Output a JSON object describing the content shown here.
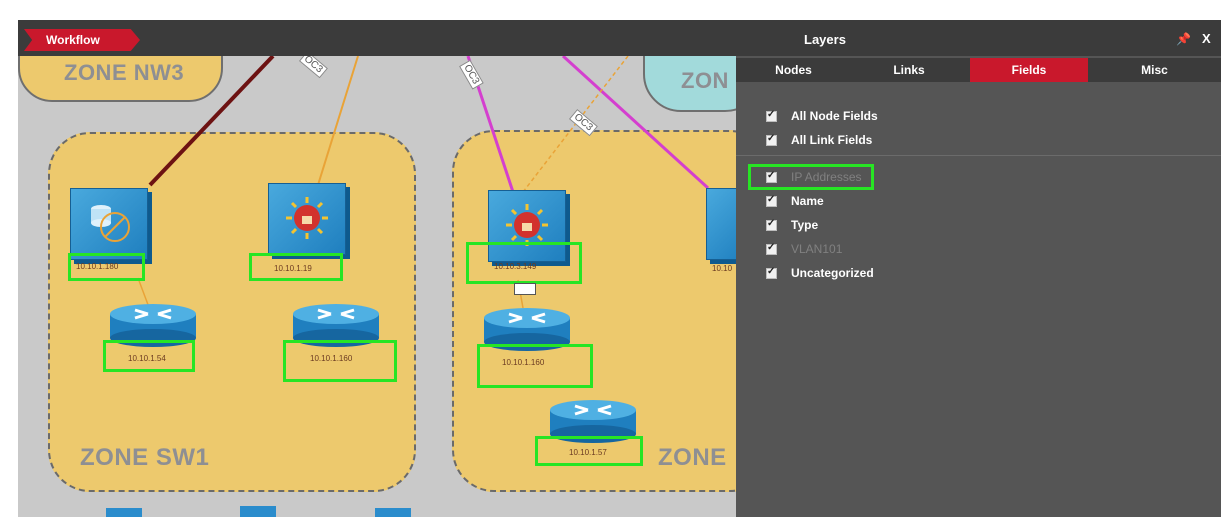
{
  "workflow": {
    "tab_label": "Workflow"
  },
  "zones": [
    {
      "label": "ZONE NW3"
    },
    {
      "label": "ZON"
    },
    {
      "label": "ZONE SW1"
    },
    {
      "label": "ZONE"
    }
  ],
  "links": [
    {
      "label": "OC3"
    },
    {
      "label": "OC3"
    },
    {
      "label": "OC3"
    }
  ],
  "devices": {
    "server_ip": "10.10.1.180",
    "firewall1_ip": "10.10.1.19",
    "firewall2_ip": "10.10.3.149",
    "partial_ip": "10.10",
    "router1_ip": "10.10.1.54",
    "router2_ip": "10.10.1.160",
    "router3_ip": "10.10.1.160",
    "router4_ip": "10.10.1.57"
  },
  "layers_panel": {
    "title": "Layers",
    "tabs": [
      {
        "label": "Nodes",
        "active": false
      },
      {
        "label": "Links",
        "active": false
      },
      {
        "label": "Fields",
        "active": true
      },
      {
        "label": "Misc",
        "active": false
      }
    ],
    "global_fields": [
      {
        "label": "All Node Fields",
        "checked": true
      },
      {
        "label": "All Link Fields",
        "checked": true
      }
    ],
    "fields": [
      {
        "label": "IP Addresses",
        "checked": true,
        "dimmed": true
      },
      {
        "label": "Name",
        "checked": true,
        "dimmed": false
      },
      {
        "label": "Type",
        "checked": true,
        "dimmed": false
      },
      {
        "label": "VLAN101",
        "checked": true,
        "dimmed": true
      },
      {
        "label": "Uncategorized",
        "checked": true,
        "dimmed": false
      }
    ]
  },
  "colors": {
    "accent": "#c9182c",
    "highlight": "#27e524",
    "zone_fill": "#edc96d"
  }
}
